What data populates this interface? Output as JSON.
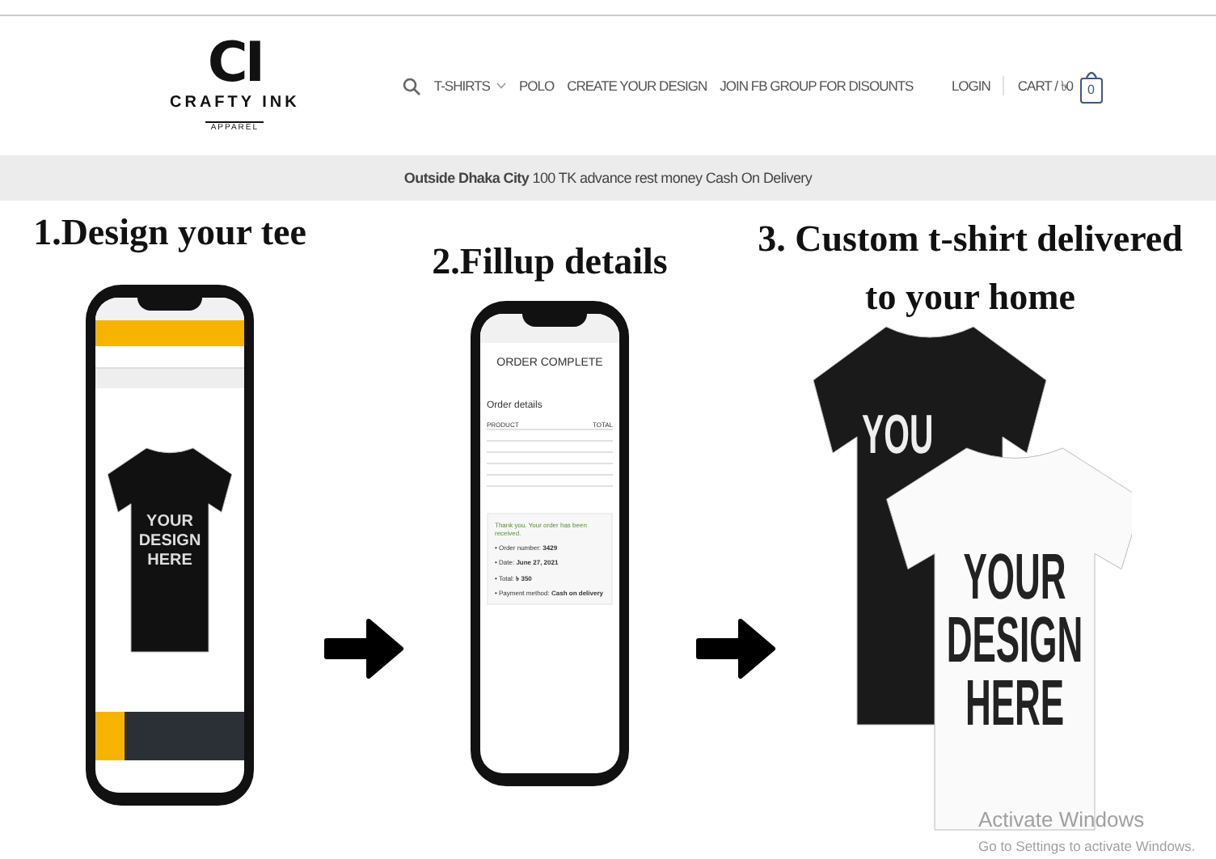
{
  "header": {
    "logo": {
      "mark": "CI",
      "name": "CRAFTY INK",
      "tagline": "APPAREL"
    },
    "nav": [
      {
        "label": "T-SHIRTS",
        "dropdown": true
      },
      {
        "label": "POLO",
        "dropdown": false
      },
      {
        "label": "CREATE YOUR DESIGN",
        "dropdown": false
      },
      {
        "label": "JOIN FB GROUP FOR DISOUNTS",
        "dropdown": false
      }
    ],
    "login": "LOGIN",
    "cart": {
      "label": "CART / ৳0",
      "count": "0"
    }
  },
  "notice": "**Outside Dhaka City** 100 TK advance rest money Cash On Delivery",
  "steps": [
    {
      "kind": "designer",
      "title": "1.Design your tee",
      "shirt_text": [
        "YOUR",
        "DESIGN",
        "HERE"
      ]
    },
    {
      "kind": "order",
      "title": "2.Fillup details",
      "heading": "ORDER COMPLETE",
      "subheading": "Order details",
      "columns": [
        "PRODUCT",
        "TOTAL"
      ],
      "thanks": "Thank you. Your order has been received.",
      "bullets": [
        "• Order number: **3429**",
        "• Date: **June 27, 2021**",
        "• Total: **৳ 350**",
        "• Payment method: **Cash on delivery**"
      ]
    },
    {
      "kind": "delivered",
      "title": "3. Custom t-shirt delivered",
      "title_line2": "to your home",
      "back_shirt_text": "YOU",
      "front_shirt_text": [
        "YOUR",
        "DESIGN",
        "HERE"
      ]
    }
  ],
  "os_watermark": {
    "title": "Activate Windows",
    "hint": "Go to Settings to activate Windows."
  }
}
